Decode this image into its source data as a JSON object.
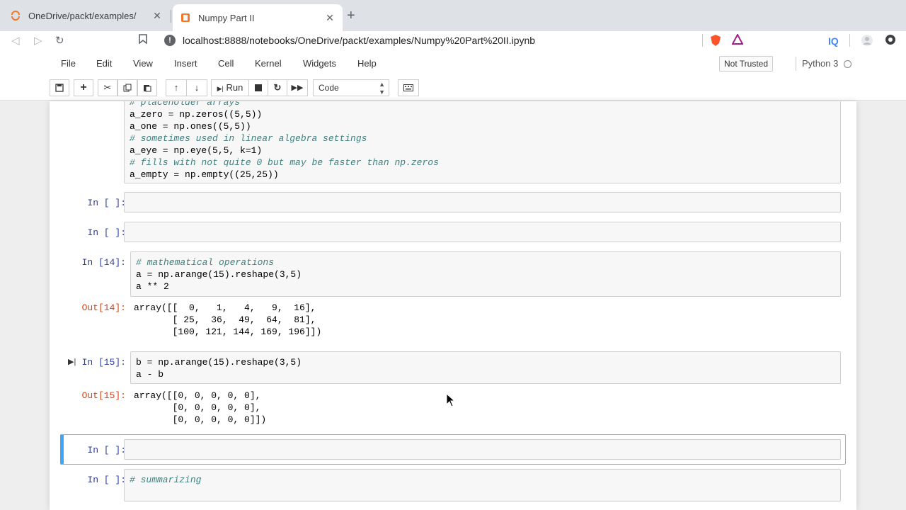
{
  "browser": {
    "tabs": [
      {
        "title": "OneDrive/packt/examples/",
        "active": false
      },
      {
        "title": "Numpy Part II",
        "active": true
      }
    ],
    "url": "localhost:8888/notebooks/OneDrive/packt/examples/Numpy%20Part%20II.ipynb"
  },
  "jupyter": {
    "menu": [
      "File",
      "Edit",
      "View",
      "Insert",
      "Cell",
      "Kernel",
      "Widgets",
      "Help"
    ],
    "trusted_label": "Not Trusted",
    "kernel": "Python 3",
    "run_label": "Run",
    "cell_type": "Code"
  },
  "cells": {
    "c0": {
      "lines": [
        "# placeholder arrays",
        "a_zero = np.zeros((5,5))",
        "a_one = np.ones((5,5))",
        "# sometimes used in linear algebra settings",
        "a_eye = np.eye(5,5, k=1)",
        "# fills with not quite 0 but may be faster than np.zeros",
        "a_empty = np.empty((25,25))"
      ]
    },
    "c1": {
      "prompt": "In [ ]:"
    },
    "c2": {
      "prompt": "In [ ]:"
    },
    "c3": {
      "prompt": "In [14]:",
      "lines": [
        "# mathematical operations",
        "a = np.arange(15).reshape(3,5)",
        "a ** 2"
      ],
      "out_prompt": "Out[14]:",
      "output": "array([[  0,   1,   4,   9,  16],\n       [ 25,  36,  49,  64,  81],\n       [100, 121, 144, 169, 196]])"
    },
    "c4": {
      "prompt": "In [15]:",
      "lines": [
        "b = np.arange(15).reshape(3,5)",
        "a - b"
      ],
      "out_prompt": "Out[15]:",
      "output": "array([[0, 0, 0, 0, 0],\n       [0, 0, 0, 0, 0],\n       [0, 0, 0, 0, 0]])"
    },
    "c5": {
      "prompt": "In [ ]:"
    },
    "c6": {
      "prompt": "In [ ]:",
      "lines": [
        "# summarizing"
      ]
    }
  },
  "colors": {
    "selected_cell_bar": "#42a5f5",
    "in_prompt": "#303f9f",
    "out_prompt": "#d84315"
  }
}
